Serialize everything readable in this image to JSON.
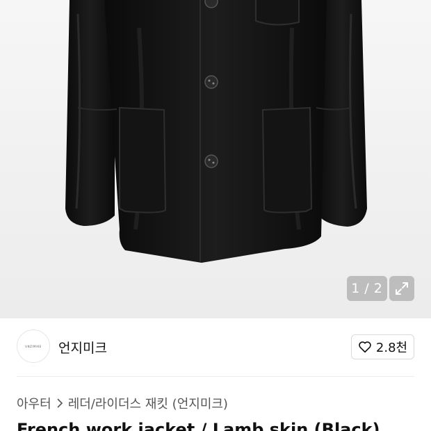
{
  "gallery": {
    "current_page": "1",
    "separator": "/",
    "total_pages": "2",
    "expand_icon": "expand-icon"
  },
  "brand": {
    "logo_text": "UNZIMIKE",
    "name": "언지미크"
  },
  "like": {
    "icon": "heart-icon",
    "count": "2.8천"
  },
  "breadcrumb": {
    "category": "아우터",
    "subcategory": "레더/라이더스 재킷 (언지미크)"
  },
  "product": {
    "title": "French work jacket / Lamb skin (Black)"
  }
}
